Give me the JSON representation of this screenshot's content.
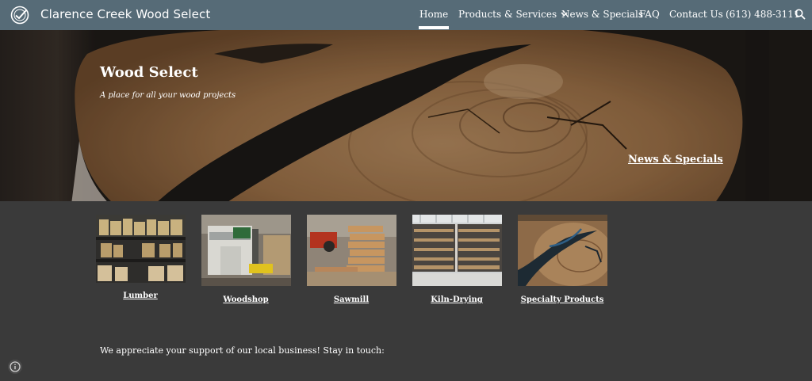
{
  "header": {
    "site_title": "Clarence Creek Wood Select",
    "nav": [
      {
        "label": "Home"
      },
      {
        "label": "Products & Services"
      },
      {
        "label": "News & Specials"
      },
      {
        "label": "FAQ"
      },
      {
        "label": "Contact Us"
      },
      {
        "label": "(613) 488-3111"
      }
    ],
    "search_icon": "search-icon",
    "logo_icon": "check-circle-logo-icon"
  },
  "hero": {
    "title": "Wood Select",
    "subtitle": "A place for all your wood projects",
    "link": "News & Specials"
  },
  "cards": [
    {
      "label": "Lumber"
    },
    {
      "label": "Woodshop"
    },
    {
      "label": "Sawmill"
    },
    {
      "label": "Kiln-Drying"
    },
    {
      "label": "Specialty Products"
    }
  ],
  "footer": {
    "message": "We appreciate your support of our local business! Stay in touch:"
  },
  "colors": {
    "nav_bg": "#566b77",
    "page_bg": "#3a3a3a",
    "text": "#ffffff"
  }
}
